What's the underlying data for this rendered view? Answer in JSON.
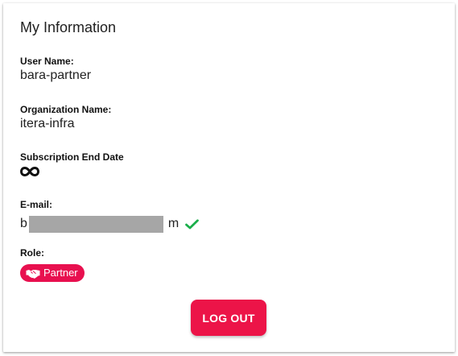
{
  "panel": {
    "title": "My Information"
  },
  "fields": {
    "user_name": {
      "label": "User Name:",
      "value": "bara-partner"
    },
    "organization_name": {
      "label": "Organization Name:",
      "value": "itera-infra"
    },
    "subscription_end_date": {
      "label": "Subscription End Date",
      "value_icon": "infinity-icon"
    },
    "email": {
      "label": "E-mail:",
      "value_prefix": "b",
      "value_suffix": "m",
      "masked": true,
      "verified_icon": "checkmark-icon",
      "verified_color": "#1aae4a"
    },
    "role": {
      "label": "Role:",
      "value": "Partner",
      "icon": "handshake-icon",
      "badge_color": "#e8104f"
    }
  },
  "actions": {
    "logout_label": "LOG OUT",
    "logout_color": "#ec1448"
  }
}
